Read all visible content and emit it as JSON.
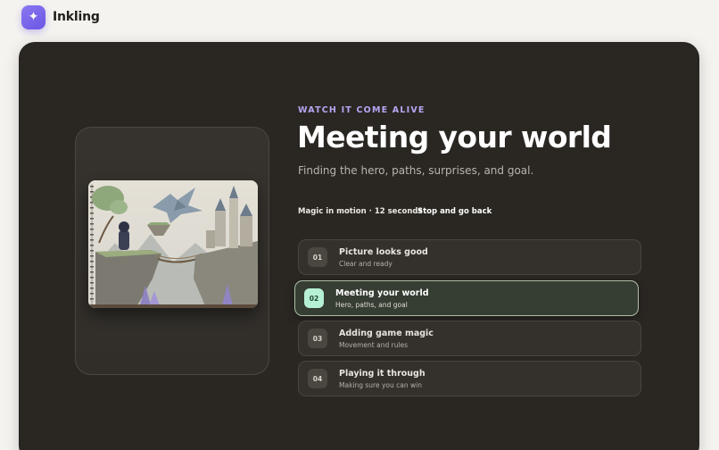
{
  "app": {
    "name": "Inkling",
    "logo_icon": "sparkle-icon",
    "accent": "#7a66ee"
  },
  "hero": {
    "eyebrow": "WATCH IT COME ALIVE",
    "title": "Meeting your world",
    "subtitle": "Finding the hero, paths, surprises, and goal."
  },
  "playback": {
    "meta": "Magic in motion · 12 seconds",
    "back_label": "Stop and go back"
  },
  "steps": [
    {
      "num": "01",
      "label": "Picture looks good",
      "desc": "Clear and ready"
    },
    {
      "num": "02",
      "label": "Meeting your world",
      "desc": "Hero, paths, and goal",
      "active": true
    },
    {
      "num": "03",
      "label": "Adding game magic",
      "desc": "Movement and rules"
    },
    {
      "num": "04",
      "label": "Playing it through",
      "desc": "Making sure you can win"
    }
  ],
  "colors": {
    "panel_bg": "#2a2723",
    "active_badge": "#b6f0d2",
    "eyebrow": "#b6a6f3"
  }
}
